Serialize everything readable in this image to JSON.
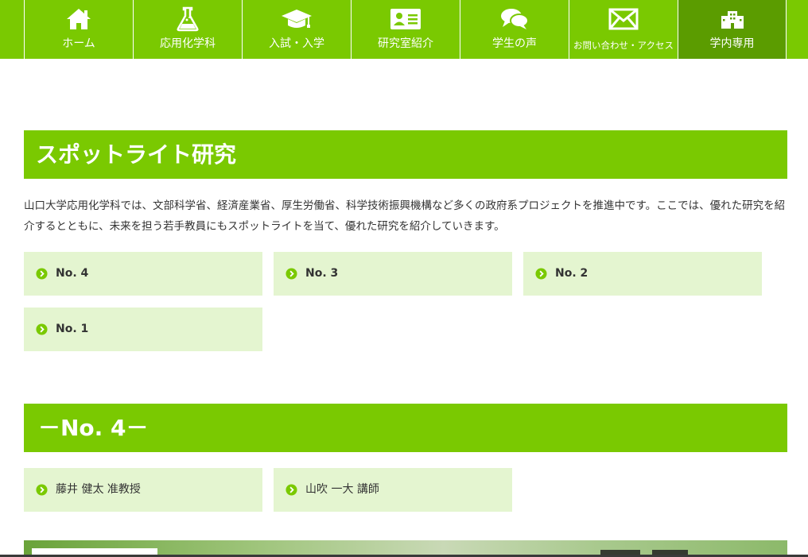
{
  "nav": {
    "items": [
      {
        "label": "ホーム",
        "icon": "home-icon"
      },
      {
        "label": "応用化学科",
        "icon": "flask-icon"
      },
      {
        "label": "入試・入学",
        "icon": "graduation-cap-icon"
      },
      {
        "label": "研究室紹介",
        "icon": "id-card-icon"
      },
      {
        "label": "学生の声",
        "icon": "chat-bubbles-icon"
      },
      {
        "label": "お問い合わせ・アクセス",
        "icon": "envelope-icon"
      },
      {
        "label": "学内専用",
        "icon": "building-icon"
      }
    ]
  },
  "spotlight": {
    "title": "スポットライト研究",
    "intro": "山口大学応用化学科では、文部科学省、経済産業省、厚生労働省、科学技術振興機構など多くの政府系プロジェクトを推進中です。ここでは、優れた研究を紹介するとともに、未来を担う若手教員にもスポットライトを当て、優れた研究を紹介していきます。",
    "issues": [
      "No. 4",
      "No. 3",
      "No. 2",
      "No. 1"
    ]
  },
  "no4": {
    "title": "－No. 4－",
    "people": [
      "藤井 健太 准教授",
      "山吹 一大 講師"
    ]
  },
  "colors": {
    "brand_green": "#7ac901",
    "active_green": "#5b9c00",
    "card_bg": "#e4f5d0"
  }
}
